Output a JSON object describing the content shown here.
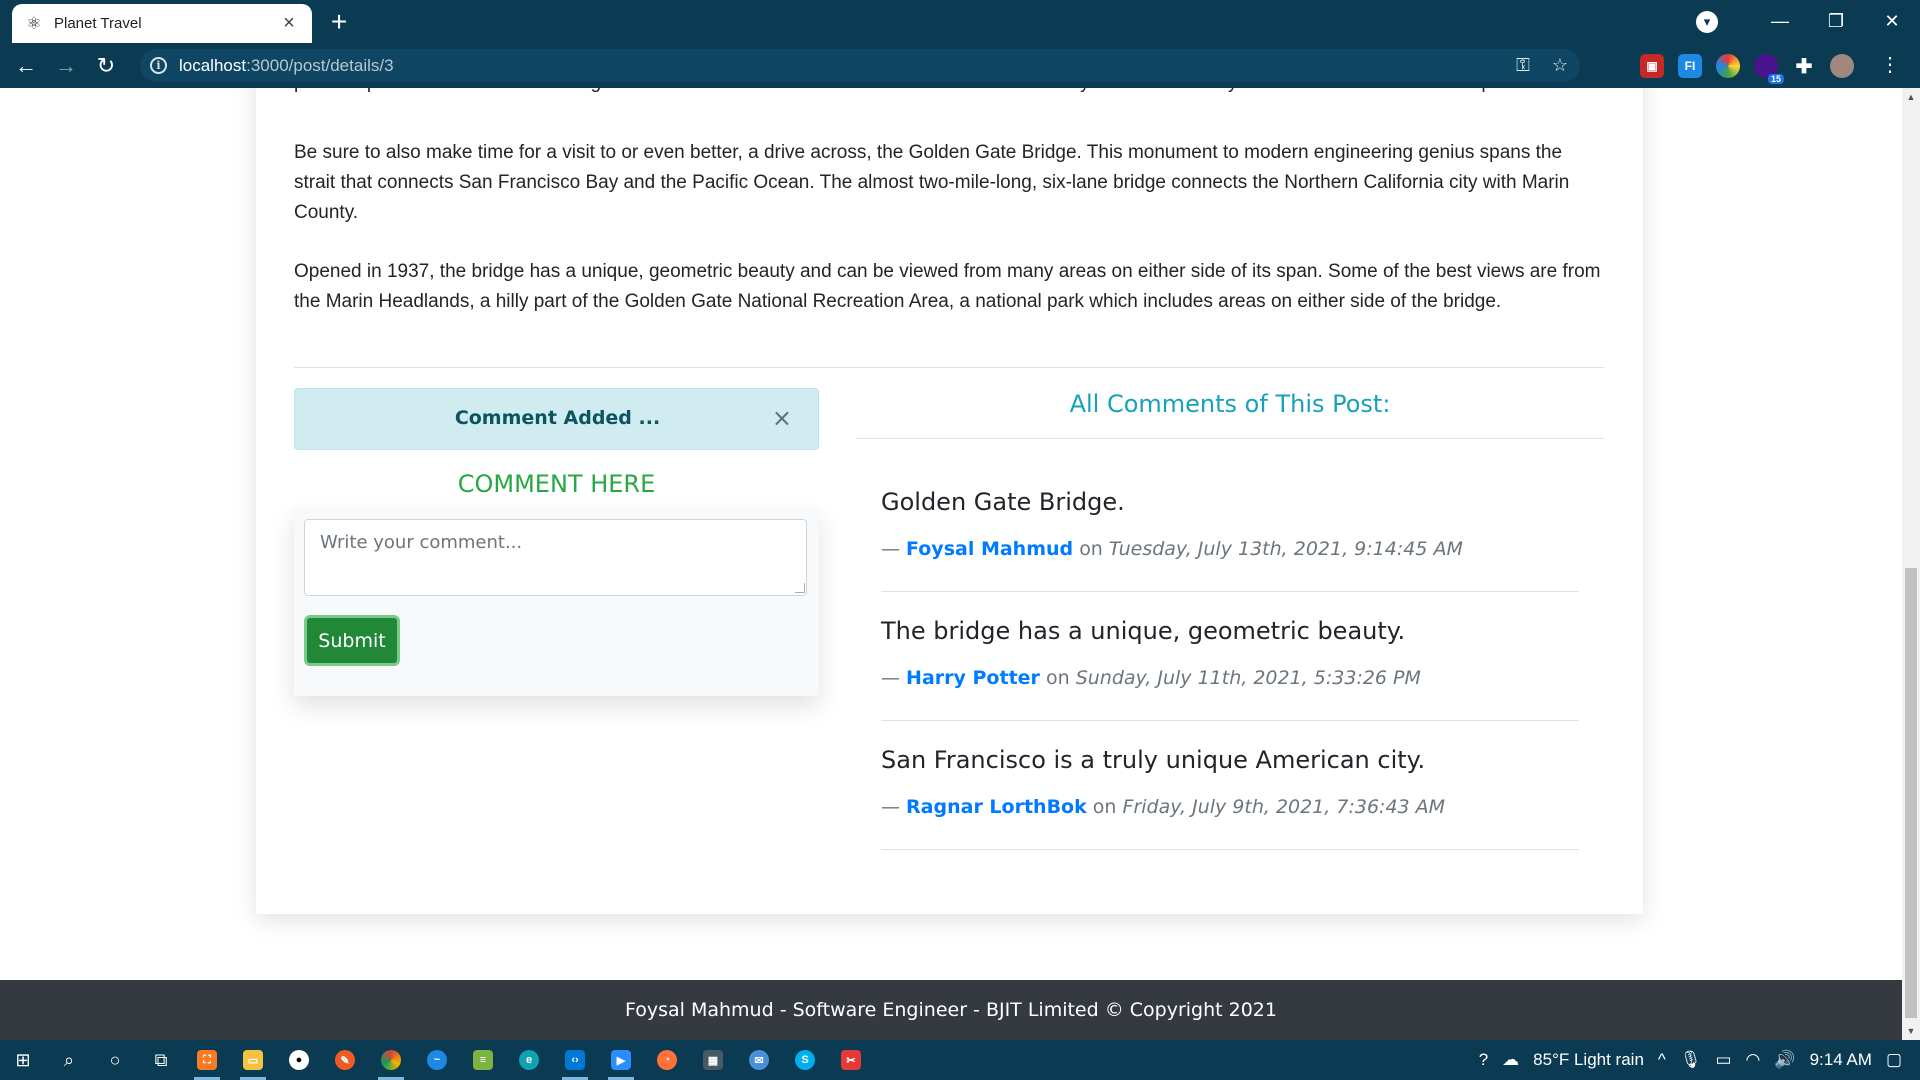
{
  "browser": {
    "tab_title": "Planet Travel",
    "url_host": "localhost",
    "url_path": ":3000/post/details/3",
    "extension_badge": "15",
    "ext_fi_label": "FI"
  },
  "article": {
    "paragraph_partial": "picturesque town of Sausalito. The giant redwoods of Muir Woods National Monument are only 30 minutes away and also well worth a side trip.",
    "paragraph_1": "Be sure to also make time for a visit to or even better, a drive across, the Golden Gate Bridge. This monument to modern engineering genius spans the strait that connects San Francisco Bay and the Pacific Ocean. The almost two-mile-long, six-lane bridge connects the Northern California city with Marin County.",
    "paragraph_2": "Opened in 1937, the bridge has a unique, geometric beauty and can be viewed from many areas on either side of its span. Some of the best views are from the Marin Headlands, a hilly part of the Golden Gate National Recreation Area, a national park which includes areas on either side of the bridge."
  },
  "alert": {
    "text": "Comment Added ...",
    "close": "×"
  },
  "comment_form": {
    "heading": "COMMENT HERE",
    "placeholder": "Write your comment...",
    "submit_label": "Submit"
  },
  "comments_section": {
    "heading": "All Comments of This Post:",
    "comments": [
      {
        "text": "Golden Gate Bridge.",
        "dash": "—",
        "author": "Foysal Mahmud",
        "on": "on",
        "date": "Tuesday, July 13th, 2021, 9:14:45 AM"
      },
      {
        "text": "The bridge has a unique, geometric beauty.",
        "dash": "—",
        "author": "Harry Potter",
        "on": "on",
        "date": "Sunday, July 11th, 2021, 5:33:26 PM"
      },
      {
        "text": "San Francisco is a truly unique American city.",
        "dash": "—",
        "author": "Ragnar LorthBok",
        "on": "on",
        "date": "Friday, July 9th, 2021, 7:36:43 AM"
      }
    ]
  },
  "footer": {
    "text": "Foysal Mahmud - Software Engineer - BJIT Limited © Copyright 2021"
  },
  "taskbar": {
    "weather": "85°F  Light rain",
    "time": "9:14 AM"
  },
  "colors": {
    "chrome": "#0b3a53",
    "success": "#28a745",
    "info": "#17a2b8",
    "link": "#007bff",
    "footer": "#343a40"
  }
}
